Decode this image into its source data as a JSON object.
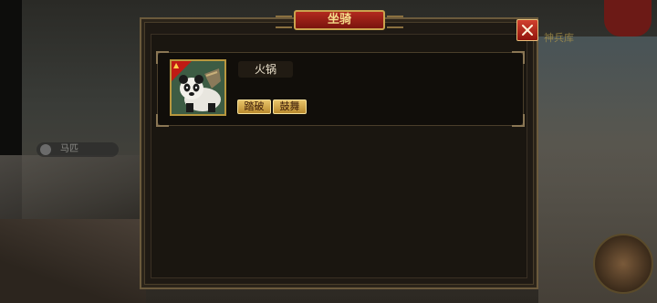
{
  "background": {
    "sidebar_entry_label": "马匹",
    "right_label": "神兵库"
  },
  "dialog": {
    "title": "坐骑",
    "close_icon": "close-icon",
    "colors": {
      "title_bg": "#9a1e14",
      "title_text": "#f5dc8a",
      "close_bg": "#c0301f",
      "skill_bg": "#d8ac4a"
    }
  },
  "mount": {
    "name": "火锅",
    "portrait_icon": "panda-mount-icon",
    "badge_icon": "rank-badge-icon",
    "skills": [
      "踏破",
      "鼓舞"
    ]
  }
}
